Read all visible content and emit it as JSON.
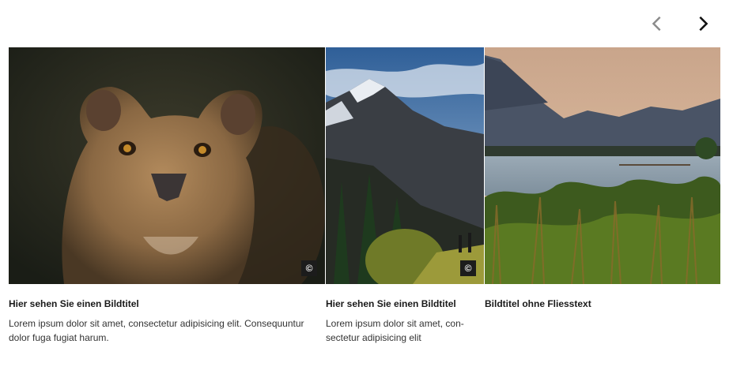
{
  "nav": {
    "prev_icon": "chevron-left-icon",
    "next_icon": "chevron-right-icon",
    "prev_color": "#8a8a8a",
    "next_color": "#111111"
  },
  "cards": [
    {
      "image": "lioness-photo",
      "copyright": "©",
      "title": "Hier sehen Sie einen Bildtitel",
      "text": "Lorem ipsum dolor sit amet, consectetur adipisicing elit. Consequuntur\ndolor fuga fugiat harum."
    },
    {
      "image": "mountain-hikers-photo",
      "copyright": "©",
      "title": "Hier sehen Sie einen Bildtitel",
      "text": "Lorem ipsum dolor sit amet, con-\nsectetur adipisicing elit"
    },
    {
      "image": "lake-reeds-photo",
      "title": "Bildtitel ohne Fliesstext"
    }
  ]
}
